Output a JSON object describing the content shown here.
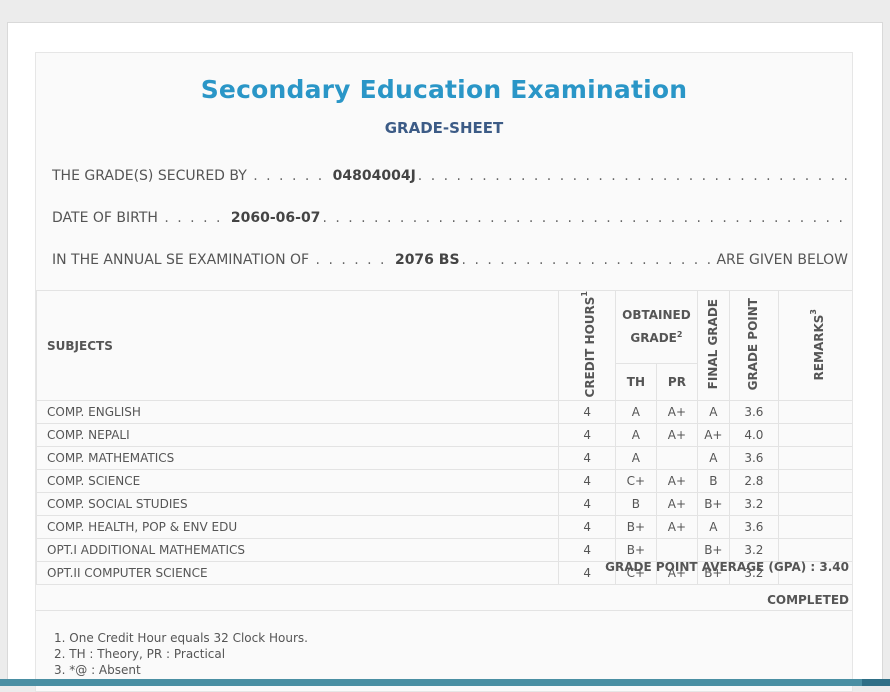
{
  "title": "Secondary Education Examination",
  "subtitle": "GRADE-SHEET",
  "info": {
    "secured_by_label": "THE GRADE(S) SECURED BY",
    "secured_by_value": "04804004J",
    "dob_label": "DATE OF BIRTH",
    "dob_value": "2060-06-07",
    "exam_label": "IN THE ANNUAL SE EXAMINATION OF",
    "exam_value": "2076 BS",
    "exam_tail": "ARE GIVEN BELOW"
  },
  "table": {
    "headers": {
      "subjects": "SUBJECTS",
      "credit_hours": "CREDIT HOURS",
      "credit_sup": "1",
      "obtained_grade": "OBTAINED GRADE",
      "obtained_sup": "2",
      "th": "TH",
      "pr": "PR",
      "final_grade": "FINAL GRADE",
      "grade_point": "GRADE POINT",
      "remarks": "REMARKS",
      "remarks_sup": "3"
    },
    "rows": [
      {
        "subject": "COMP. ENGLISH",
        "credit": "4",
        "th": "A",
        "pr": "A+",
        "final": "A",
        "gp": "3.6",
        "remarks": ""
      },
      {
        "subject": "COMP. NEPALI",
        "credit": "4",
        "th": "A",
        "pr": "A+",
        "final": "A+",
        "gp": "4.0",
        "remarks": ""
      },
      {
        "subject": "COMP. MATHEMATICS",
        "credit": "4",
        "th": "A",
        "pr": "",
        "final": "A",
        "gp": "3.6",
        "remarks": ""
      },
      {
        "subject": "COMP. SCIENCE",
        "credit": "4",
        "th": "C+",
        "pr": "A+",
        "final": "B",
        "gp": "2.8",
        "remarks": ""
      },
      {
        "subject": "COMP. SOCIAL STUDIES",
        "credit": "4",
        "th": "B",
        "pr": "A+",
        "final": "B+",
        "gp": "3.2",
        "remarks": ""
      },
      {
        "subject": "COMP. HEALTH, POP & ENV EDU",
        "credit": "4",
        "th": "B+",
        "pr": "A+",
        "final": "A",
        "gp": "3.6",
        "remarks": ""
      },
      {
        "subject": "OPT.I ADDITIONAL MATHEMATICS",
        "credit": "4",
        "th": "B+",
        "pr": "",
        "final": "B+",
        "gp": "3.2",
        "remarks": ""
      },
      {
        "subject": "OPT.II COMPUTER SCIENCE",
        "credit": "4",
        "th": "C+",
        "pr": "A+",
        "final": "B+",
        "gp": "3.2",
        "remarks": ""
      }
    ]
  },
  "gpa_text": "GRADE POINT AVERAGE (GPA) : 3.40",
  "status_text": "COMPLETED",
  "notes": [
    "1. One Credit Hour equals 32 Clock Hours.",
    "2. TH : Theory, PR : Practical",
    "3. *@ : Absent"
  ]
}
